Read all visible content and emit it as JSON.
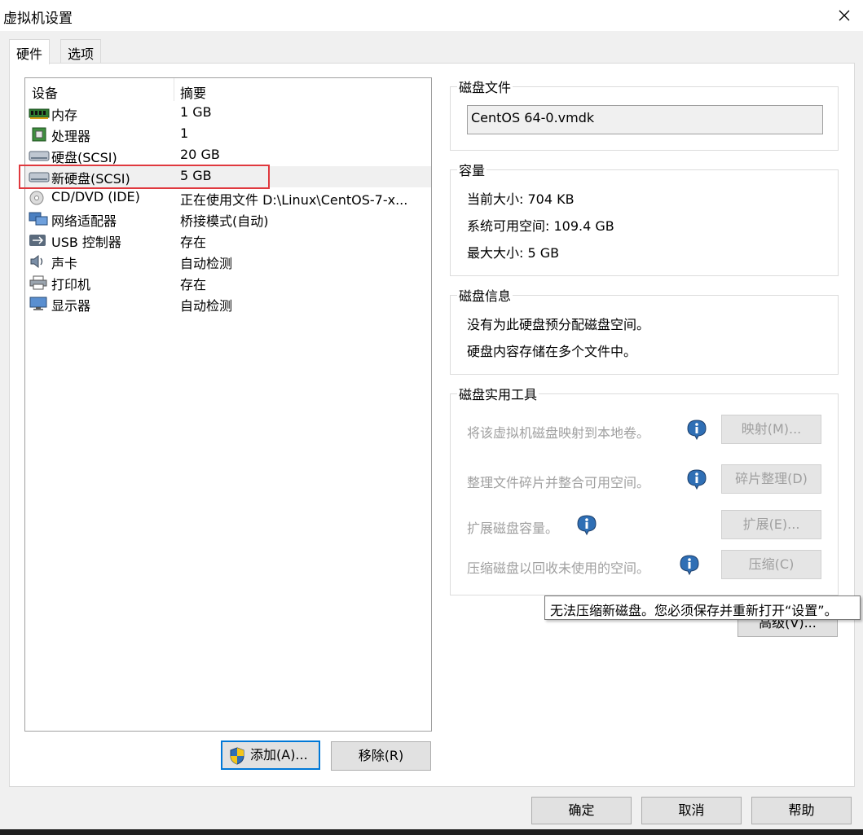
{
  "window": {
    "title": "虚拟机设置"
  },
  "tabs": [
    {
      "label": "硬件"
    },
    {
      "label": "选项"
    }
  ],
  "device_list": {
    "col_device": "设备",
    "col_summary": "摘要",
    "rows": [
      {
        "name": "内存",
        "summary": "1 GB",
        "icon": "memory-icon"
      },
      {
        "name": "处理器",
        "summary": "1",
        "icon": "processor-icon"
      },
      {
        "name": "硬盘(SCSI)",
        "summary": "20 GB",
        "icon": "hard-disk-icon"
      },
      {
        "name": "新硬盘(SCSI)",
        "summary": "5 GB",
        "icon": "hard-disk-icon"
      },
      {
        "name": "CD/DVD (IDE)",
        "summary": "正在使用文件 D:\\Linux\\CentOS-7-x...",
        "icon": "cd-dvd-icon"
      },
      {
        "name": "网络适配器",
        "summary": "桥接模式(自动)",
        "icon": "network-adapter-icon"
      },
      {
        "name": "USB 控制器",
        "summary": "存在",
        "icon": "usb-icon"
      },
      {
        "name": "声卡",
        "summary": "自动检测",
        "icon": "sound-card-icon"
      },
      {
        "name": "打印机",
        "summary": "存在",
        "icon": "printer-icon"
      },
      {
        "name": "显示器",
        "summary": "自动检测",
        "icon": "display-icon"
      }
    ],
    "selected_index": 3,
    "highlight_color": "#e0393e"
  },
  "list_buttons": {
    "add": "添加(A)...",
    "remove": "移除(R)"
  },
  "disk_file": {
    "title": "磁盘文件",
    "value": "CentOS 64-0.vmdk"
  },
  "capacity": {
    "title": "容量",
    "current_label": "当前大小:",
    "current_value": "704 KB",
    "free_label": "系统可用空间:",
    "free_value": "109.4 GB",
    "max_label": "最大大小:",
    "max_value": "5 GB"
  },
  "disk_info": {
    "title": "磁盘信息",
    "line1": "没有为此硬盘预分配磁盘空间。",
    "line2": "硬盘内容存储在多个文件中。"
  },
  "disk_utilities": {
    "title": "磁盘实用工具",
    "map_label": "将该虚拟机磁盘映射到本地卷。",
    "map_button": "映射(M)...",
    "defrag_label": "整理文件碎片并整合可用空间。",
    "defrag_button": "碎片整理(D)",
    "expand_label": "扩展磁盘容量。",
    "expand_button": "扩展(E)...",
    "compact_label": "压缩磁盘以回收未使用的空间。",
    "compact_button": "压缩(C)"
  },
  "advanced_button": "高级(V)...",
  "tooltip": "无法压缩新磁盘。您必须保存并重新打开“设置”。",
  "footer": {
    "ok": "确定",
    "cancel": "取消",
    "help": "帮助"
  },
  "colors": {
    "accent": "#0078d7",
    "disabled_text": "#a0a0a0",
    "info_blue": "#2f6fb5"
  }
}
